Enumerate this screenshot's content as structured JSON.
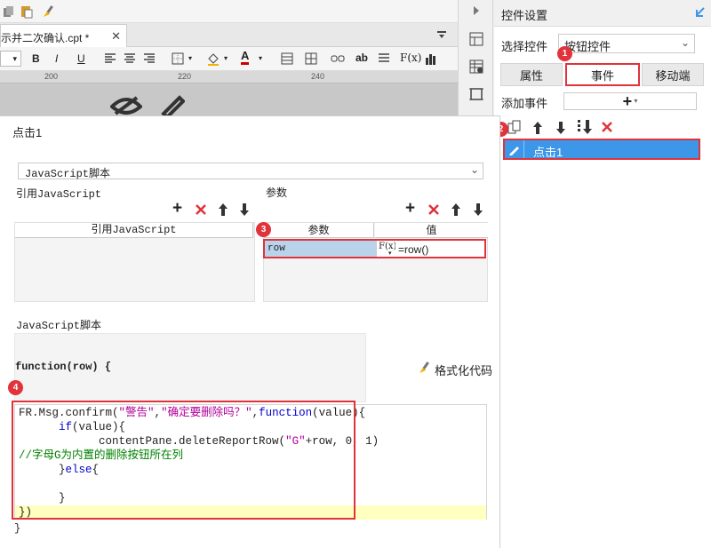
{
  "editor": {
    "tab_label": "示并二次确认.cpt *",
    "ruler_marks": [
      "200",
      "220",
      "240"
    ],
    "format_fx_label": "F(x)"
  },
  "right_panel": {
    "title": "控件设置",
    "select_widget_label": "选择控件",
    "select_widget_value": "按钮控件",
    "tabs": [
      "属性",
      "事件",
      "移动端"
    ],
    "add_event_label": "添加事件",
    "add_event_button": "+",
    "events": [
      {
        "label": "点击1",
        "selected": true
      }
    ]
  },
  "dialog": {
    "title": "点击1",
    "script_type": "JavaScript脚本",
    "ref_js_section": "引用JavaScript",
    "ref_js_header": "引用JavaScript",
    "params_section": "参数",
    "params_headers": [
      "参数",
      "值"
    ],
    "params_rows": [
      {
        "name": "row",
        "fx": "F(x)",
        "value": "=row()"
      }
    ],
    "script_section": "JavaScript脚本",
    "function_signature": "function(row) {",
    "format_code_label": "格式化代码",
    "closing_brace": "}"
  },
  "code_lines": [
    [
      {
        "t": "FR.Msg.confirm(",
        "c": "p"
      },
      {
        "t": "\"警告\"",
        "c": "s"
      },
      {
        "t": ",",
        "c": "p"
      },
      {
        "t": "\"确定要删除吗？\"",
        "c": "s"
      },
      {
        "t": ",",
        "c": "p"
      },
      {
        "t": "function",
        "c": "k"
      },
      {
        "t": "(value){",
        "c": "p"
      }
    ],
    [
      {
        "t": "      ",
        "c": "p"
      },
      {
        "t": "if",
        "c": "k"
      },
      {
        "t": "(value){",
        "c": "p"
      }
    ],
    [
      {
        "t": "            contentPane.deleteReportRow(",
        "c": "p"
      },
      {
        "t": "\"G\"",
        "c": "s"
      },
      {
        "t": "+row, 0, 1)",
        "c": "p"
      }
    ],
    [
      {
        "t": "//字母G为内置的删除按钮所在列",
        "c": "m"
      }
    ],
    [
      {
        "t": "      }",
        "c": "p"
      },
      {
        "t": "else",
        "c": "k"
      },
      {
        "t": "{",
        "c": "p"
      }
    ],
    [
      {
        "t": "",
        "c": "p"
      }
    ],
    [
      {
        "t": "      }",
        "c": "p"
      }
    ],
    [
      {
        "t": "})",
        "c": "p"
      }
    ]
  ],
  "annotations": [
    "1",
    "2",
    "3",
    "4"
  ],
  "colors": {
    "accent": "#3c97e8",
    "highlight_red": "#e0333b",
    "selected_row": "#3c97e8",
    "code_keyword": "#0000cc",
    "code_string": "#b0009a",
    "code_comment": "#008000"
  }
}
